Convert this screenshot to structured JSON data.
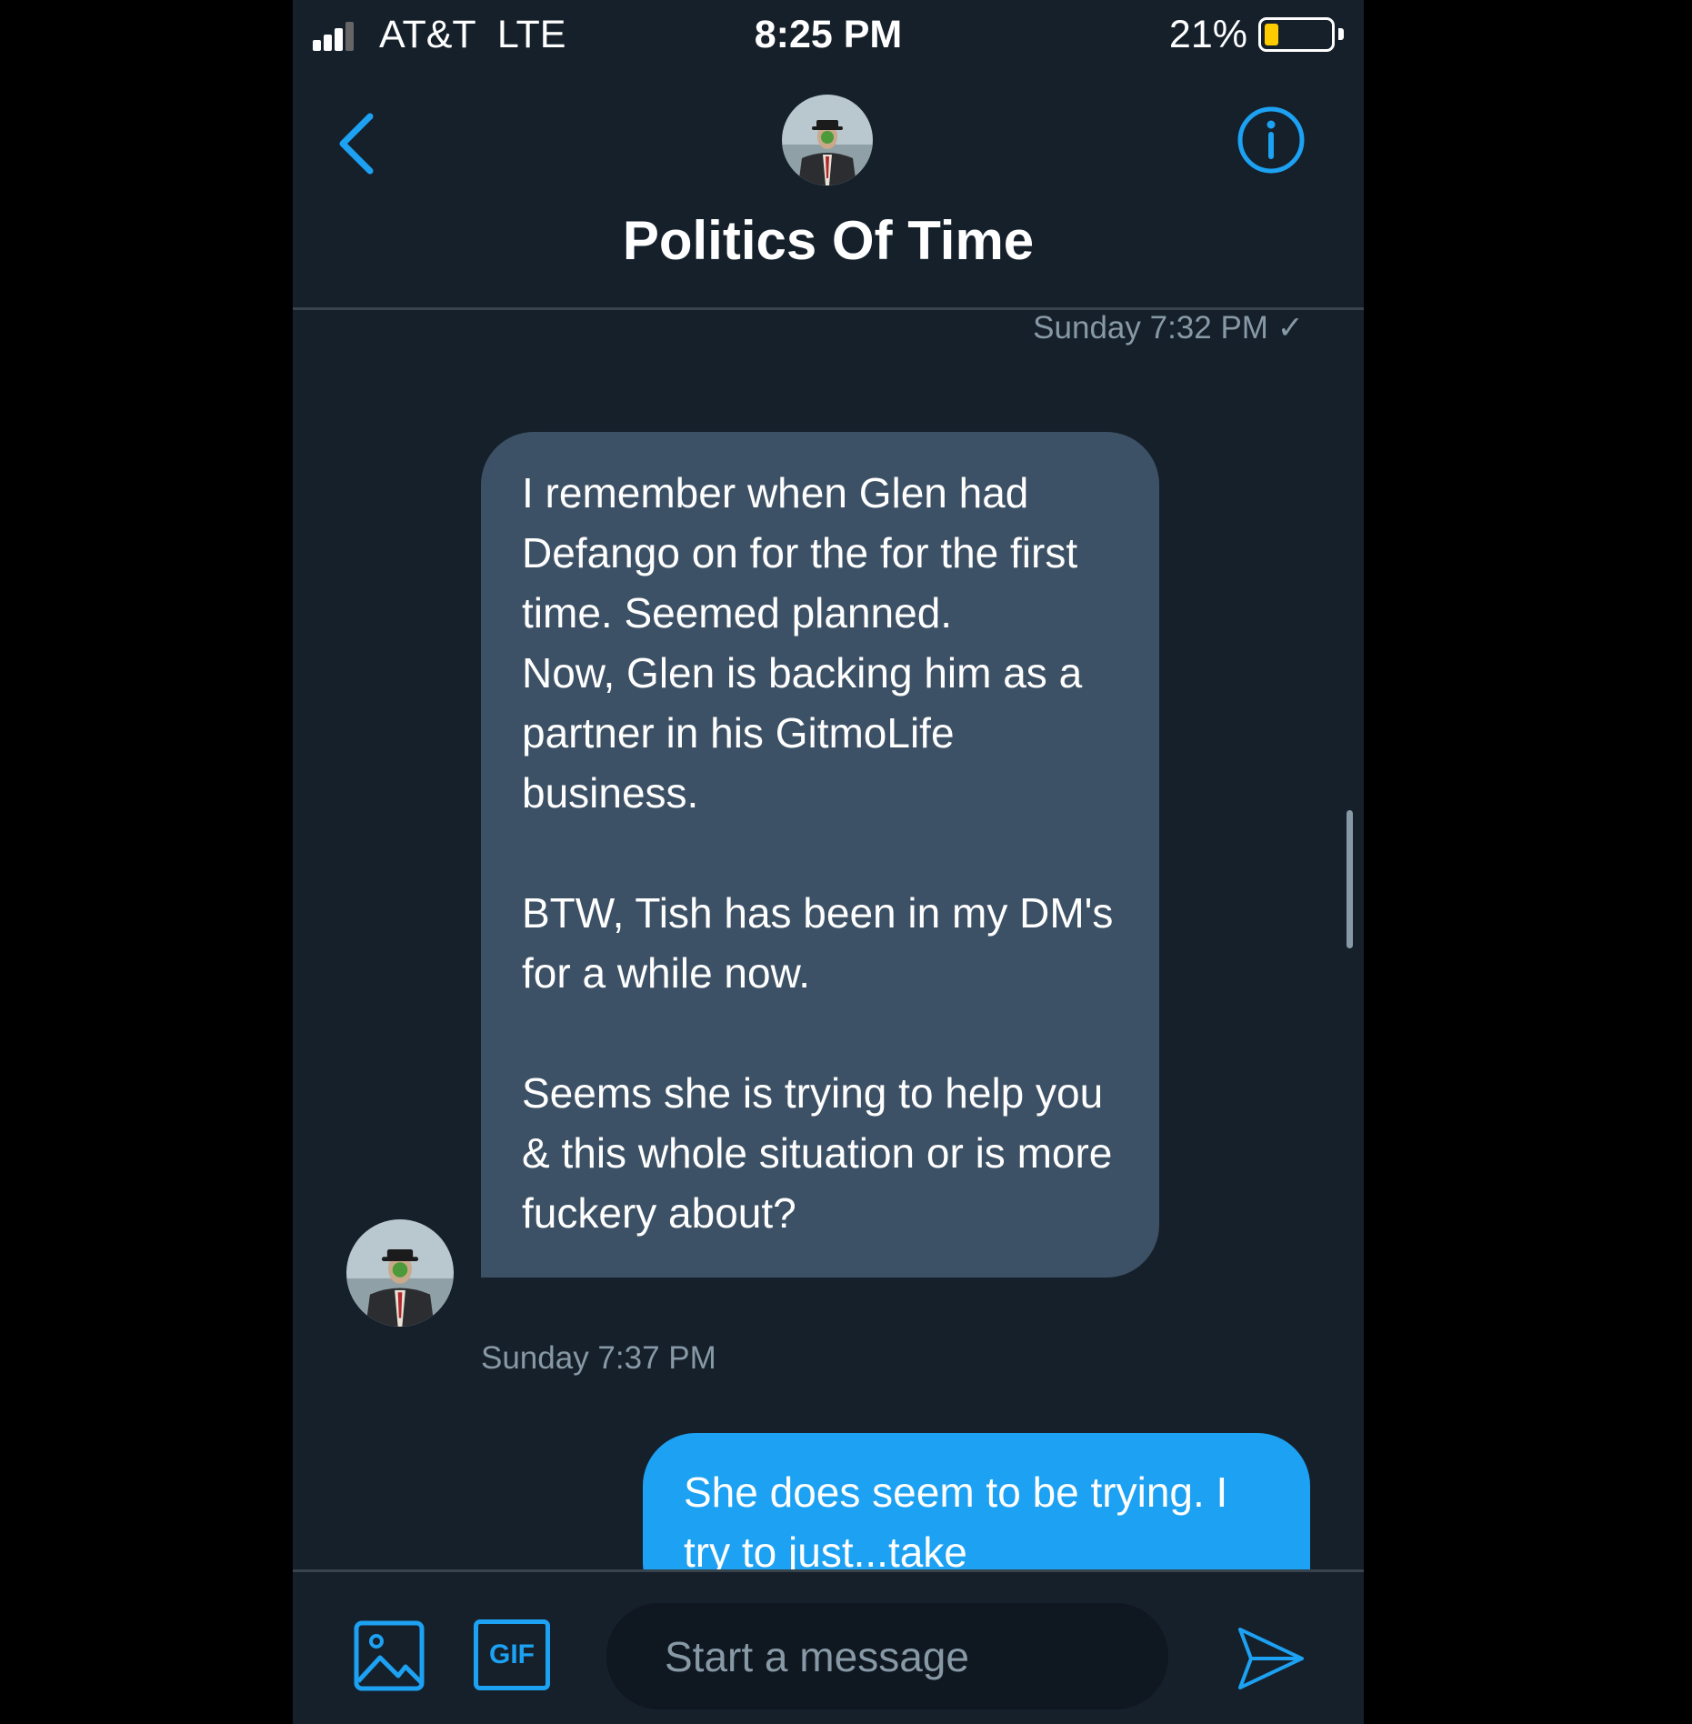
{
  "status_bar": {
    "carrier": "AT&T  LTE",
    "time": "8:25 PM",
    "battery_percent": "21%",
    "battery_level": 0.21,
    "battery_color": "#ffcc00"
  },
  "header": {
    "title": "Politics Of Time",
    "back_icon": "chevron-left-icon",
    "info_icon": "info-icon"
  },
  "messages": {
    "timestamp_top": "Sunday 7:32 PM ✓",
    "incoming": {
      "paragraphs": [
        "I remember when Glen had Defango on for the for the first time. Seemed planned.\nNow, Glen is backing him as a partner in his GitmoLife business.",
        "BTW, Tish has been in my DM's for a while now.",
        "Seems she is trying to help you & this whole situation or is more fuckery about?"
      ],
      "timestamp": "Sunday 7:37 PM"
    },
    "outgoing": {
      "text": "She does seem to be trying. I try to just...take"
    }
  },
  "composer": {
    "placeholder": "Start a message",
    "gif_label": "GIF",
    "image_icon": "image-icon",
    "send_icon": "send-icon"
  },
  "colors": {
    "background": "#15202b",
    "accent": "#1da1f2",
    "incoming_bubble": "#3d5166",
    "muted_text": "#8899a6"
  }
}
